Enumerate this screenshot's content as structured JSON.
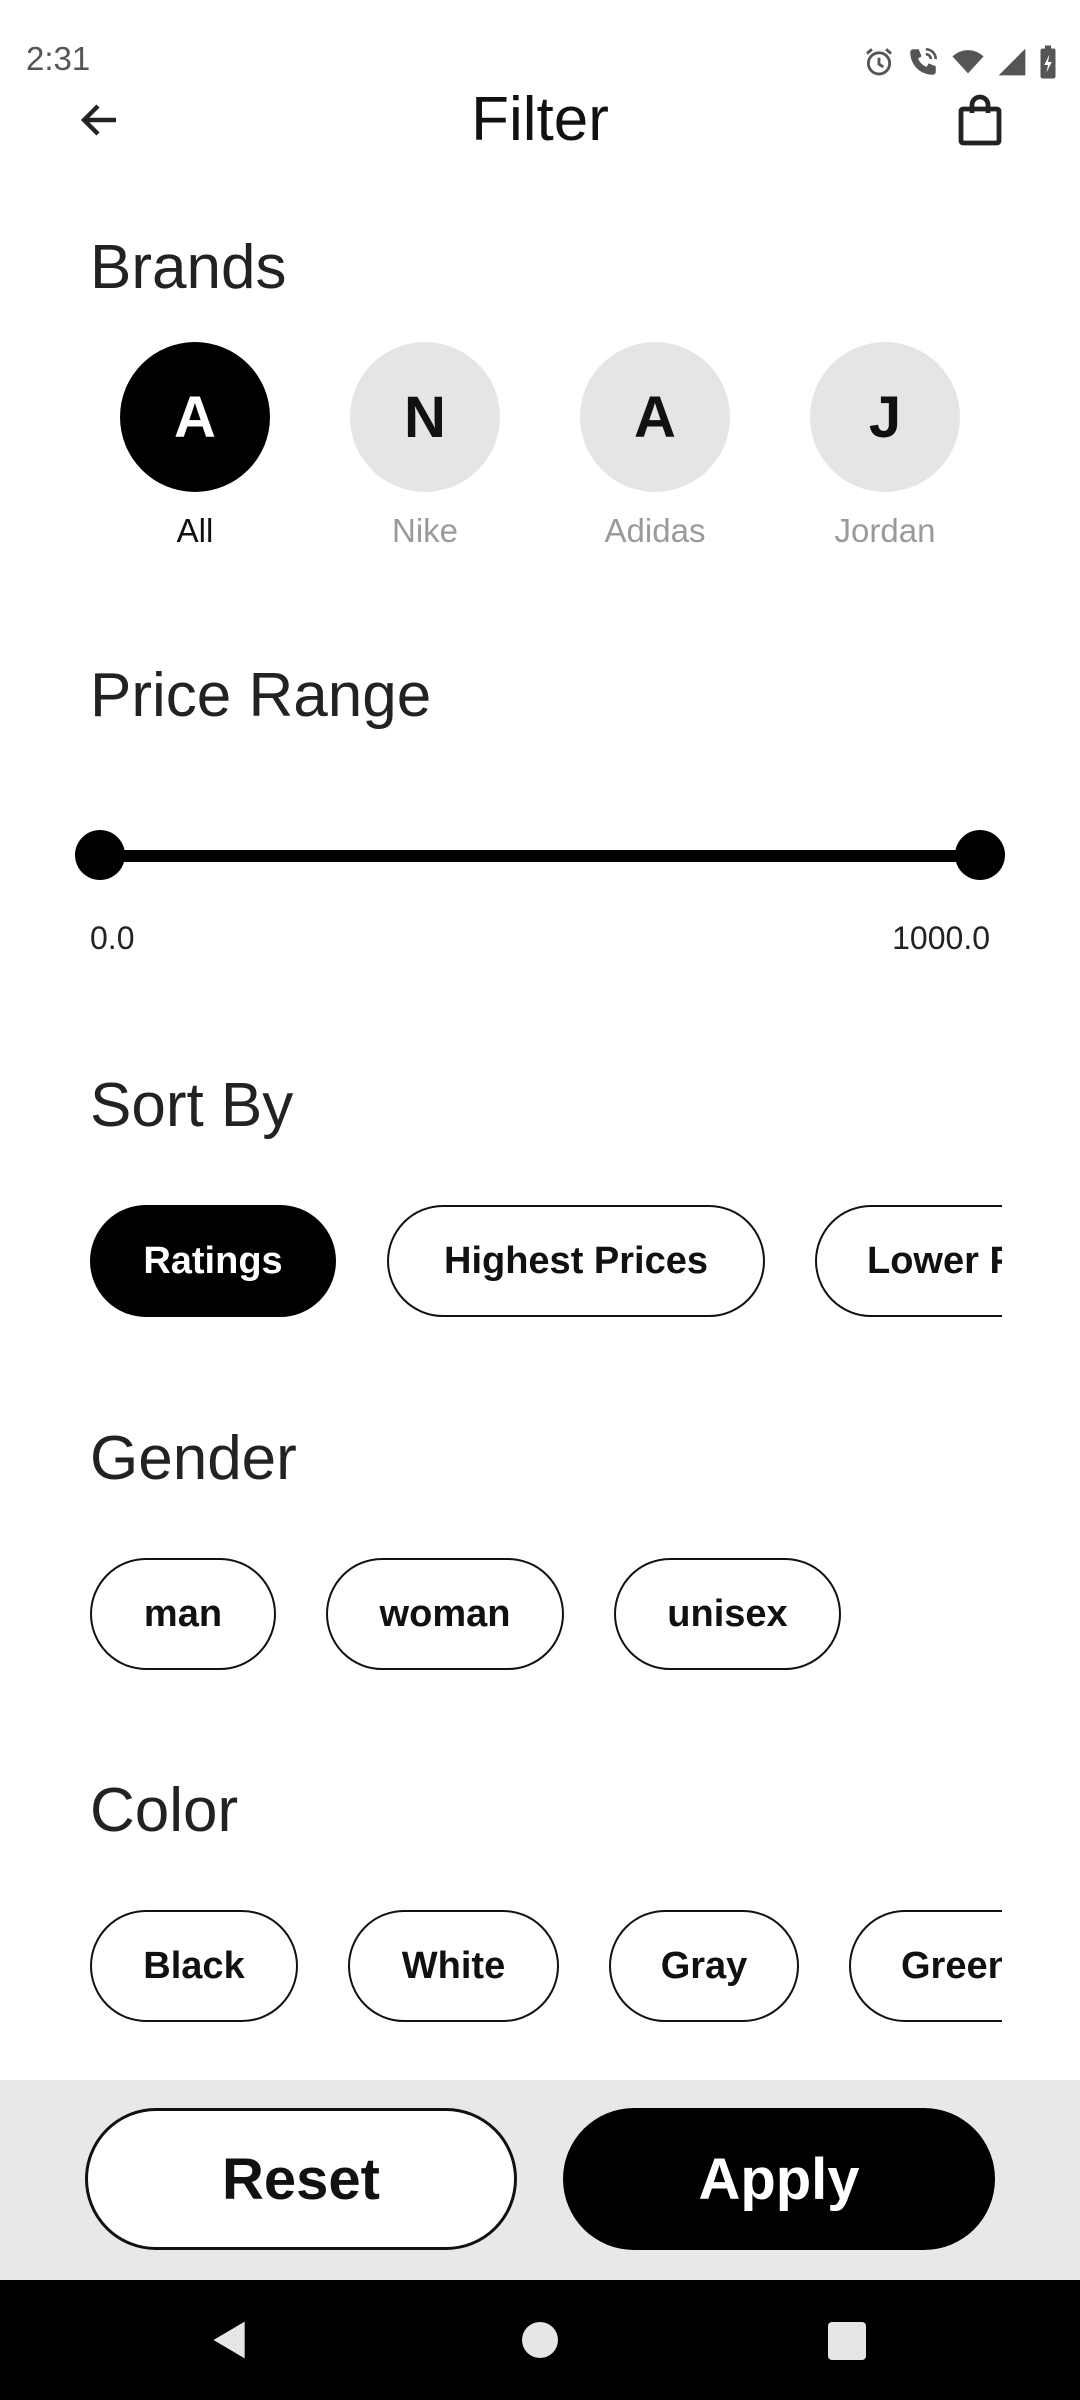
{
  "status": {
    "time": "2:31",
    "icons": [
      "alarm-icon",
      "wifi-calling-icon",
      "wifi-icon",
      "cell-signal-icon",
      "battery-charging-icon"
    ]
  },
  "header": {
    "title": "Filter",
    "back_icon": "arrow-left-icon",
    "bag_icon": "shopping-bag-icon"
  },
  "brands": {
    "title": "Brands",
    "items": [
      {
        "initial": "A",
        "label": "All",
        "selected": true
      },
      {
        "initial": "N",
        "label": "Nike",
        "selected": false
      },
      {
        "initial": "A",
        "label": "Adidas",
        "selected": false
      },
      {
        "initial": "J",
        "label": "Jordan",
        "selected": false
      }
    ]
  },
  "price": {
    "title": "Price Range",
    "min_label": "0.0",
    "max_label": "1000.0"
  },
  "sort": {
    "title": "Sort By",
    "options": [
      {
        "label": "Ratings",
        "selected": true
      },
      {
        "label": "Highest Prices",
        "selected": false
      },
      {
        "label": "Lower Prices",
        "selected": false
      }
    ]
  },
  "gender": {
    "title": "Gender",
    "options": [
      {
        "label": "man"
      },
      {
        "label": "woman"
      },
      {
        "label": "unisex"
      }
    ]
  },
  "color": {
    "title": "Color",
    "options": [
      {
        "label": "Black"
      },
      {
        "label": "White"
      },
      {
        "label": "Gray"
      },
      {
        "label": "Green"
      }
    ]
  },
  "actions": {
    "reset_label": "Reset",
    "apply_label": "Apply"
  },
  "colors": {
    "accent": "#000000",
    "chip_inactive_bg": "#ffffff",
    "brand_inactive_bg": "#e5e5e5",
    "bottom_bar_bg": "#e8e8e8"
  }
}
